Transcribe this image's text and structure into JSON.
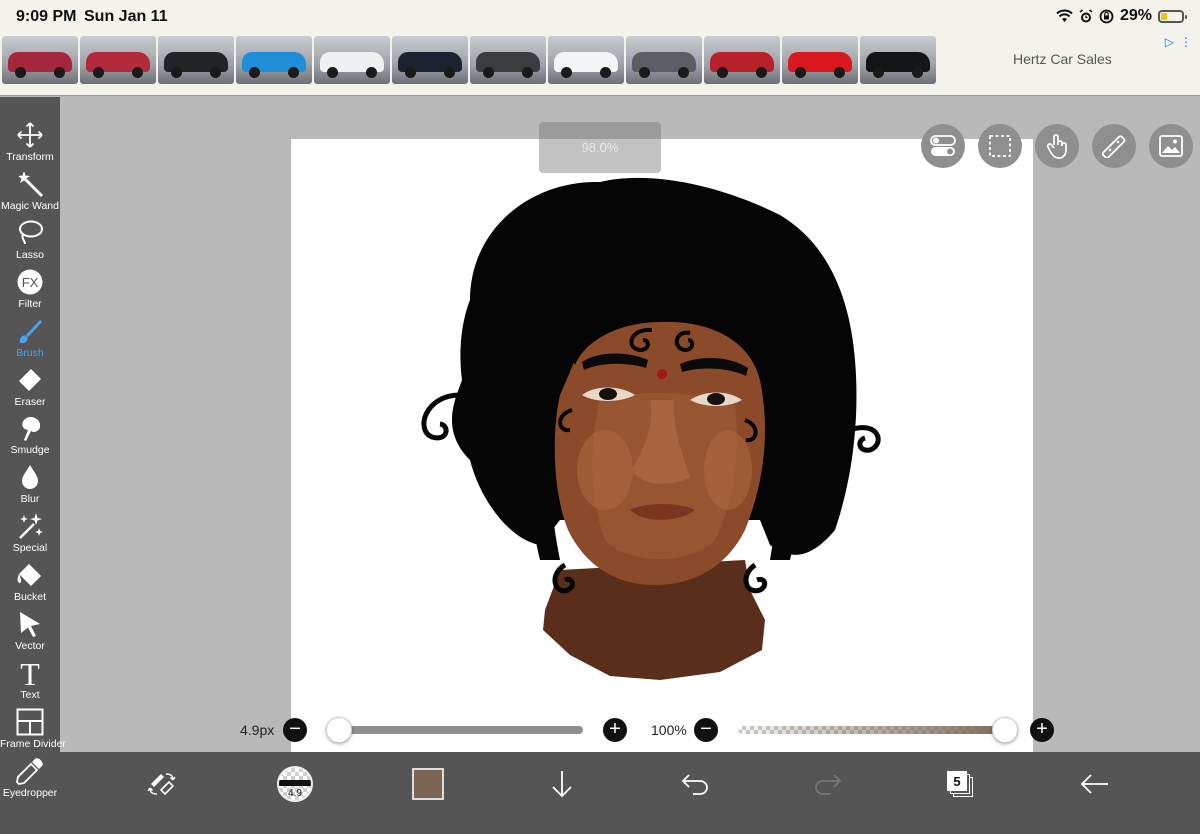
{
  "status_bar": {
    "time": "9:09 PM",
    "date": "Sun Jan 11",
    "battery_percent_text": "29%",
    "battery_level": 0.29,
    "icons": [
      "wifi-icon",
      "alarm-icon",
      "orientation-lock-icon",
      "battery-icon"
    ]
  },
  "ad": {
    "brand": "Hertz Car Sales",
    "car_colors": [
      "#a3263a",
      "#b22a3c",
      "#222426",
      "#1e8fd6",
      "#eef0f2",
      "#1c2230",
      "#3a3c3e",
      "#f2f4f6",
      "#5a5e64",
      "#b8202c",
      "#d8181e",
      "#121416"
    ],
    "icons": [
      "ad-choices-icon",
      "ad-close-icon"
    ]
  },
  "tools": [
    {
      "id": "transform",
      "label": "Transform",
      "icon": "move-arrows-icon"
    },
    {
      "id": "magic-wand",
      "label": "Magic Wand",
      "icon": "magic-wand-icon"
    },
    {
      "id": "lasso",
      "label": "Lasso",
      "icon": "lasso-icon"
    },
    {
      "id": "filter",
      "label": "Filter",
      "icon": "fx-icon",
      "glyph": "FX"
    },
    {
      "id": "brush",
      "label": "Brush",
      "icon": "brush-icon",
      "active": true
    },
    {
      "id": "eraser",
      "label": "Eraser",
      "icon": "eraser-icon"
    },
    {
      "id": "smudge",
      "label": "Smudge",
      "icon": "smudge-icon"
    },
    {
      "id": "blur",
      "label": "Blur",
      "icon": "drop-icon"
    },
    {
      "id": "special",
      "label": "Special",
      "icon": "sparkle-icon"
    },
    {
      "id": "bucket",
      "label": "Bucket",
      "icon": "bucket-icon"
    },
    {
      "id": "vector",
      "label": "Vector",
      "icon": "pointer-icon"
    },
    {
      "id": "text",
      "label": "Text",
      "icon": "text-icon",
      "glyph": "T"
    },
    {
      "id": "frame-divider",
      "label": "Frame Divider",
      "icon": "frame-divider-icon"
    },
    {
      "id": "eyedropper",
      "label": "Eyedropper",
      "icon": "eyedropper-icon"
    }
  ],
  "canvas": {
    "zoom_tooltip": "98.0%"
  },
  "floating_buttons": [
    "toggle-icon",
    "selection-icon",
    "touch-icon",
    "ruler-icon",
    "image-icon"
  ],
  "brush_size": {
    "label": "4.9px",
    "minus": "−",
    "plus": "+",
    "value_fraction": 0.03
  },
  "opacity": {
    "label": "100%",
    "minus": "−",
    "plus": "+",
    "value_fraction": 1.0
  },
  "bottom_bar": {
    "brush_preview_value": "4.9",
    "current_color": "#7b6553",
    "layer_count": "5",
    "icons": [
      "swap-tools-icon",
      "brush-preview-icon",
      "color-swatch",
      "download-icon",
      "undo-icon",
      "redo-icon",
      "layers-icon",
      "back-arrow-icon"
    ]
  }
}
